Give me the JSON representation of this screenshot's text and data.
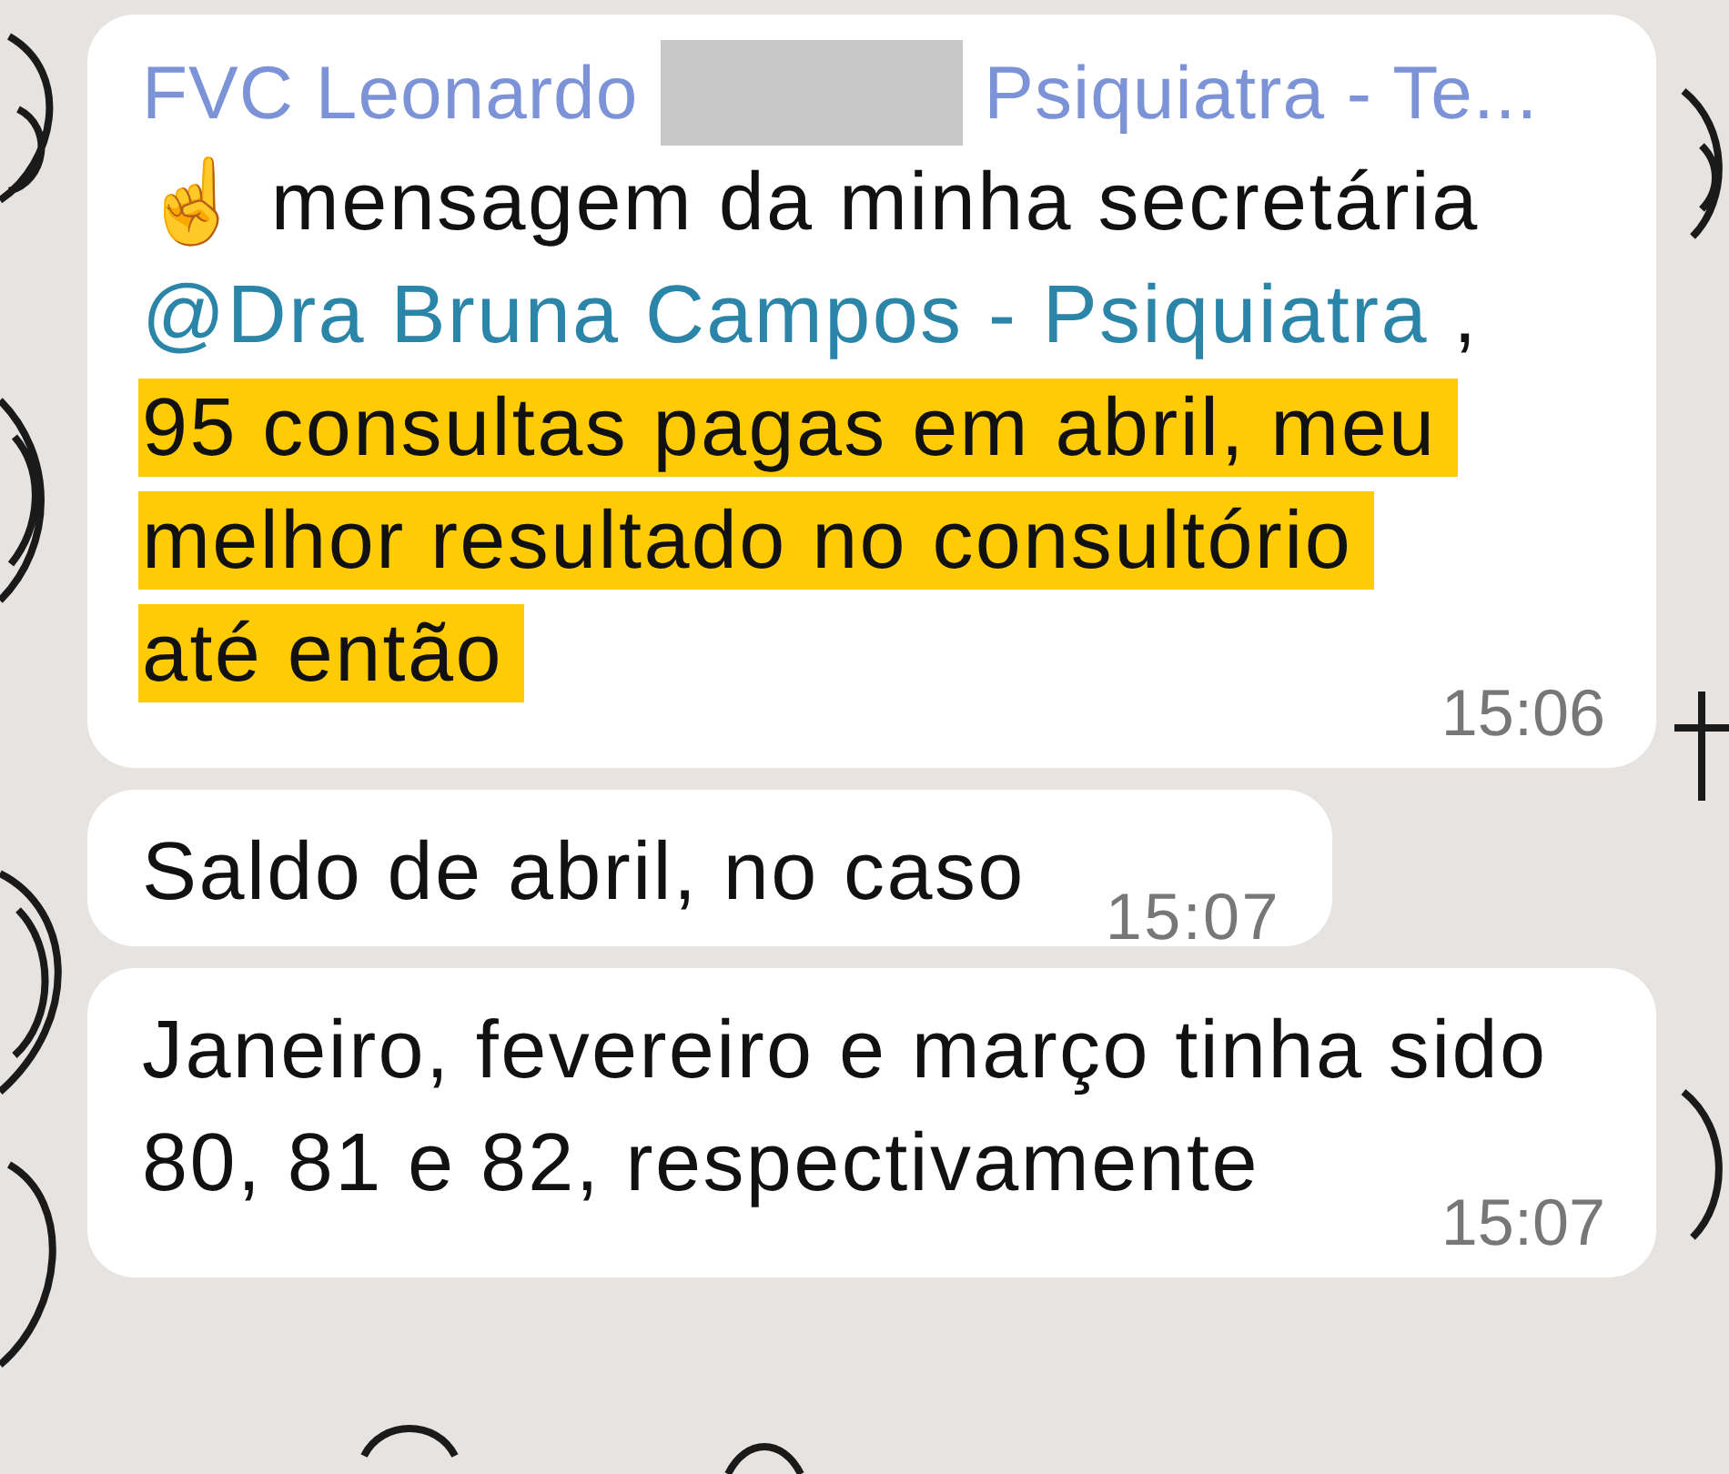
{
  "messages": [
    {
      "sender": "FVC Leonardo",
      "sender_redacted": true,
      "sender_suffix": "Psiquiatra - Te...",
      "paragraphs": [
        [
          {
            "kind": "emoji",
            "text": "☝"
          },
          {
            "kind": "text",
            "text": " mensagem da minha secretária"
          }
        ],
        [
          {
            "kind": "mention",
            "text": "@Dra Bruna Campos - Psiquiatra"
          },
          {
            "kind": "text",
            "text": " ,"
          }
        ],
        [
          {
            "kind": "highlight",
            "text": "95 consultas pagas em abril, meu"
          }
        ],
        [
          {
            "kind": "highlight",
            "text": "melhor resultado no consultório"
          }
        ],
        [
          {
            "kind": "highlight",
            "text": "até então"
          }
        ]
      ],
      "time": "15:06",
      "time_inline": false
    },
    {
      "paragraphs": [
        [
          {
            "kind": "text",
            "text": "Saldo de abril, no caso"
          }
        ]
      ],
      "time": "15:07",
      "time_inline": true
    },
    {
      "paragraphs": [
        [
          {
            "kind": "text",
            "text": "Janeiro, fevereiro e março tinha sido 80, 81 e 82, respectivamente"
          }
        ]
      ],
      "time": "15:07",
      "time_inline": false
    }
  ]
}
